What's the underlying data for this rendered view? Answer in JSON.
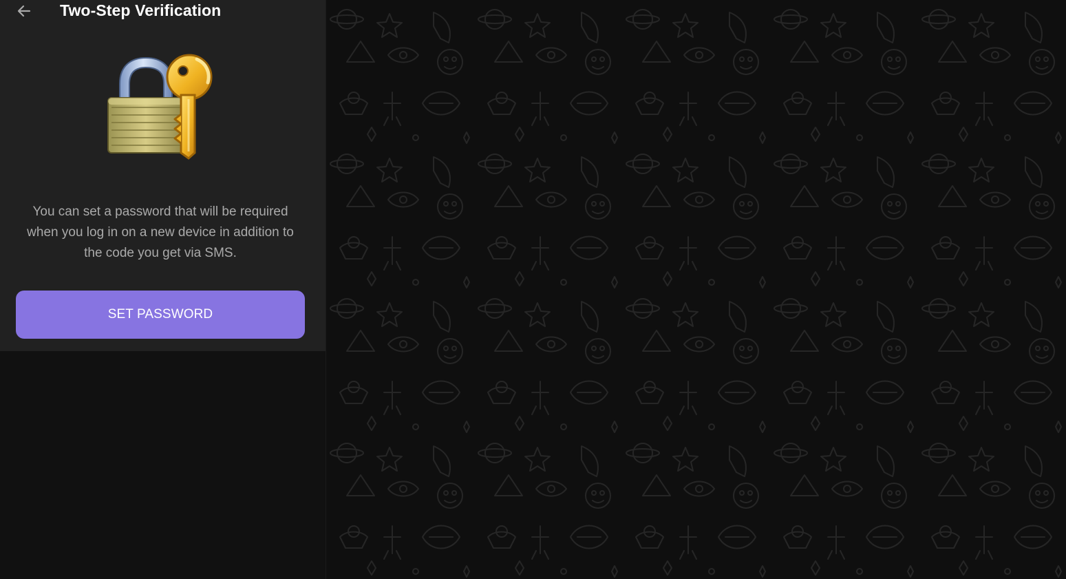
{
  "settings": {
    "title": "Two-Step Verification",
    "description": "You can set a password that will be required when you log in on a new device in addition to the code you get via SMS.",
    "set_password_label": "SET PASSWORD"
  },
  "icons": {
    "back": "arrow-left-icon",
    "illustration": "lock-and-key-icon"
  },
  "colors": {
    "accent": "#8774e1",
    "panel_background": "#212121",
    "app_background": "#0f0f0f",
    "secondary_text": "#aaaaaa",
    "primary_text": "#ffffff"
  }
}
